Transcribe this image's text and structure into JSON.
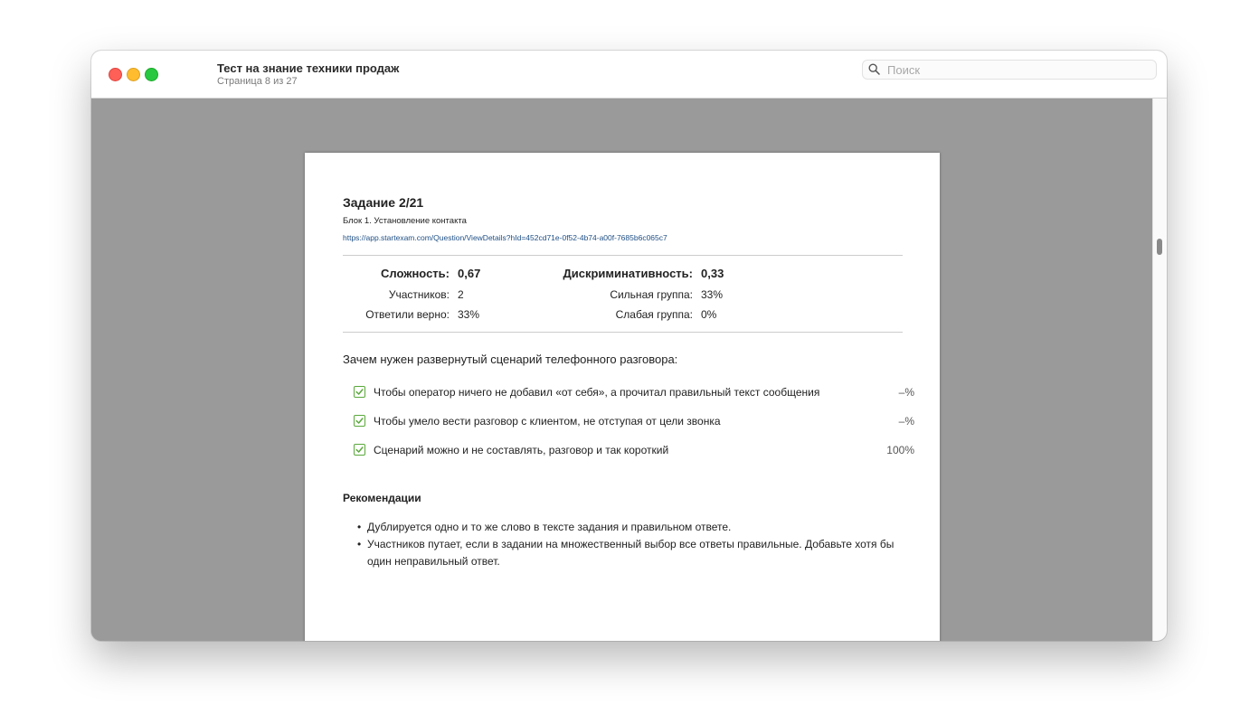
{
  "window": {
    "title": "Тест на знание техники продаж",
    "subtitle": "Страница 8 из 27",
    "search_placeholder": "Поиск"
  },
  "page": {
    "task_title": "Задание 2/21",
    "block_name": "Блок 1. Установление контакта",
    "link": "https://app.startexam.com/Question/ViewDetails?hId=452cd71e-0f52-4b74-a00f-7685b6c065c7",
    "stats": {
      "difficulty_label": "Сложность:",
      "difficulty_value": "0,67",
      "participants_label": "Участников:",
      "participants_value": "2",
      "correct_label": "Ответили верно:",
      "correct_value": "33%",
      "discrimination_label": "Дискриминативность:",
      "discrimination_value": "0,33",
      "strong_label": "Сильная группа:",
      "strong_value": "33%",
      "weak_label": "Слабая группа:",
      "weak_value": "0%"
    },
    "question": "Зачем нужен развернутый сценарий телефонного разговора:",
    "answers": [
      {
        "text": "Чтобы оператор ничего не добавил «от себя», а прочитал правильный текст сообщения",
        "percent": "–%",
        "checked": true
      },
      {
        "text": "Чтобы умело вести разговор с клиентом, не отступая от цели звонка",
        "percent": "–%",
        "checked": true
      },
      {
        "text": "Сценарий можно и не составлять, разговор и так короткий",
        "percent": "100%",
        "checked": true
      }
    ],
    "recommendations_title": "Рекомендации",
    "recommendations": [
      "Дублируется одно и то же слово в тексте задания и правильном ответе.",
      "Участников путает, если в задании на множественный выбор все ответы правильные. Добавьте хотя бы один неправильный ответ."
    ]
  },
  "colors": {
    "accent_check": "#5aa83b",
    "link": "#1f4f86",
    "viewer_background": "#9a9a9a"
  }
}
